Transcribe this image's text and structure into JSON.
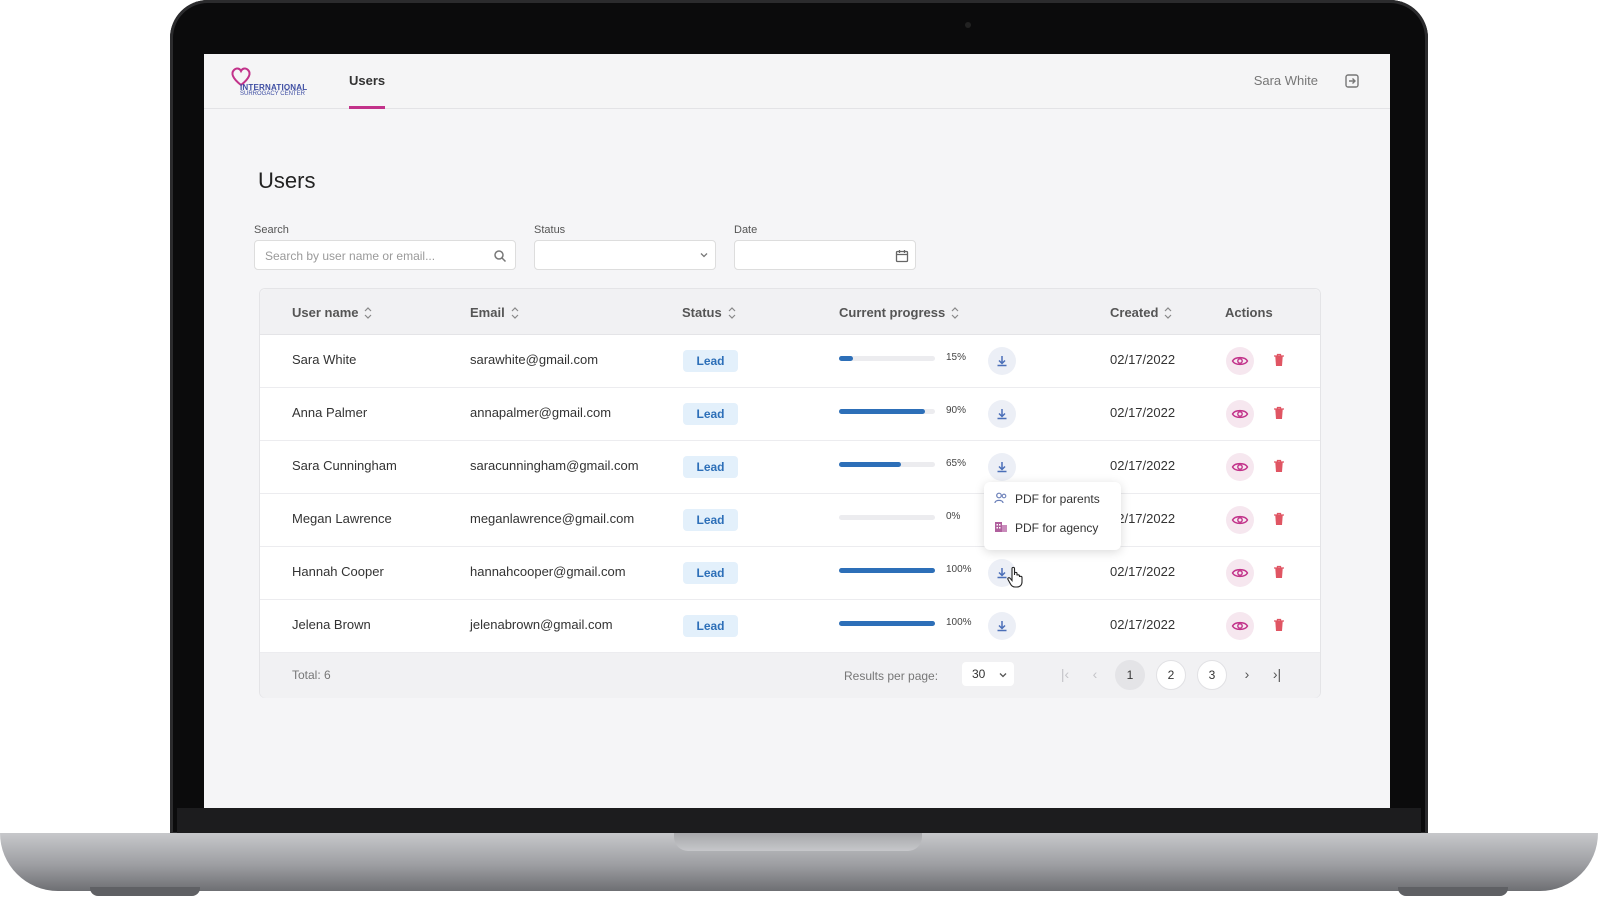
{
  "app": {
    "logo_line1": "INTERNATIONAL",
    "logo_line2": "SURROGACY CENTER",
    "nav_tab": "Users",
    "user_name": "Sara White"
  },
  "page": {
    "title": "Users",
    "filters": {
      "search_label": "Search",
      "search_placeholder": "Search by user name or email...",
      "status_label": "Status",
      "status_value": "",
      "date_label": "Date",
      "date_value": ""
    }
  },
  "table": {
    "columns": [
      "User name",
      "Email",
      "Status",
      "Current progress",
      "Created",
      "Actions"
    ],
    "rows": [
      {
        "name": "Sara White",
        "email": "sarawhite@gmail.com",
        "status": "Lead",
        "progress": "15%",
        "progress_value": 15,
        "created": "02/17/2022"
      },
      {
        "name": "Anna Palmer",
        "email": "annapalmer@gmail.com",
        "status": "Lead",
        "progress": "90%",
        "progress_value": 90,
        "created": "02/17/2022"
      },
      {
        "name": "Sara Cunningham",
        "email": "saracunningham@gmail.com",
        "status": "Lead",
        "progress": "65%",
        "progress_value": 65,
        "created": "02/17/2022"
      },
      {
        "name": "Megan Lawrence",
        "email": "meganlawrence@gmail.com",
        "status": "Lead",
        "progress": "0%",
        "progress_value": 0,
        "created": "02/17/2022"
      },
      {
        "name": "Hannah Cooper",
        "email": "hannahcooper@gmail.com",
        "status": "Lead",
        "progress": "100%",
        "progress_value": 100,
        "created": "02/17/2022"
      },
      {
        "name": "Jelena Brown",
        "email": "jelenabrown@gmail.com",
        "status": "Lead",
        "progress": "100%",
        "progress_value": 100,
        "created": "02/17/2022"
      }
    ],
    "total": "Total: 6",
    "results_per_page_label": "Results per page:",
    "results_per_page_value": "30",
    "pages": [
      "1",
      "2",
      "3"
    ],
    "active_page": "1"
  },
  "download_menu": {
    "items": [
      "PDF for parents",
      "PDF for agency"
    ]
  },
  "colors": {
    "accent_pink": "#c2328a",
    "progress_blue": "#2d6fb8",
    "badge_bg": "#e3f0fb",
    "trash_red": "#e05563"
  },
  "icons": {
    "search": "search-icon",
    "calendar": "calendar-icon",
    "chevron": "chevron-down-icon",
    "download": "download-icon",
    "view": "eye-icon",
    "delete": "trash-icon",
    "logout": "logout-icon"
  }
}
